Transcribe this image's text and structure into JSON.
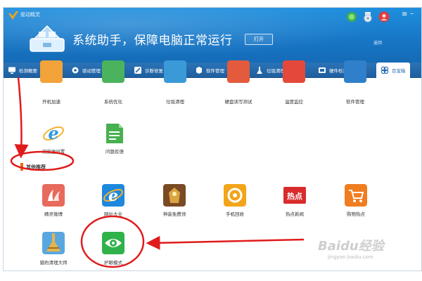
{
  "app": {
    "title": "驱动精灵",
    "slogan": "系统助手，保障电脑正常运行",
    "open_label": "打开",
    "return_label": "返回"
  },
  "tabs": [
    {
      "label": "检测概要",
      "icon": "monitor-icon"
    },
    {
      "label": "驱动管理",
      "icon": "gear-icon"
    },
    {
      "label": "诊断修复",
      "icon": "wrench-icon"
    },
    {
      "label": "软件管理",
      "icon": "software-icon"
    },
    {
      "label": "垃圾清理",
      "icon": "broom-icon"
    },
    {
      "label": "硬件检测",
      "icon": "hardware-icon"
    },
    {
      "label": "百宝箱",
      "icon": "toolbox-icon",
      "active": true
    }
  ],
  "top_row": [
    "开机加速",
    "系统优化",
    "垃圾清理",
    "硬盘读写测试",
    "温度监控",
    "软件管理"
  ],
  "tools_row": [
    {
      "label": "浏览器设置",
      "icon": "ie-browser-icon"
    },
    {
      "label": "问题反馈",
      "icon": "feedback-icon"
    }
  ],
  "section_title": "其他推荐",
  "recommend_row": [
    {
      "label": "精灵微博",
      "icon": "weibo-icon"
    },
    {
      "label": "网址大全",
      "icon": "ie-browser-icon"
    },
    {
      "label": "神装免费领",
      "icon": "armor-icon"
    },
    {
      "label": "手机回收",
      "icon": "recycle-icon"
    },
    {
      "label": "热点新闻",
      "icon": "hot-news-icon"
    },
    {
      "label": "购物热点",
      "icon": "cart-icon"
    }
  ],
  "bottom_row": [
    {
      "label": "猎豹清理大师",
      "icon": "broom-icon"
    },
    {
      "label": "护眼模式",
      "icon": "eye-icon"
    }
  ],
  "hot_badge": "热点",
  "watermark": {
    "brand": "Baidu经验",
    "url": "jingyan.baidu.com"
  },
  "colors": {
    "header": "#1b82d2",
    "tabbar": "#2468ab",
    "annotation": "#e01b1b",
    "accent": "#ee6a16"
  }
}
